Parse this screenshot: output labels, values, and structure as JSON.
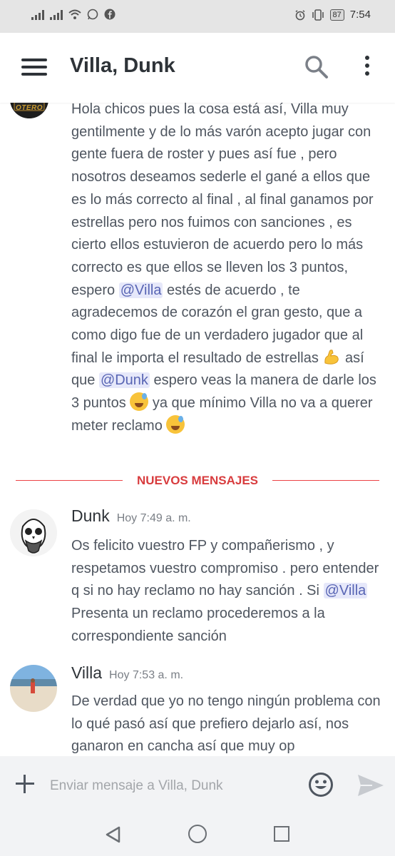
{
  "status_bar": {
    "time": "7:54",
    "battery": "87",
    "left_icons": [
      "signal-icon",
      "signal-icon",
      "wifi-icon",
      "whatsapp-icon",
      "facebook-icon"
    ],
    "right_icons": [
      "alarm-icon",
      "vibrate-icon",
      "battery-icon"
    ]
  },
  "header": {
    "title": "Villa, Dunk",
    "icons": [
      "menu-icon",
      "search-icon",
      "more-vert-icon"
    ]
  },
  "messages": {
    "first_message": {
      "avatar_label": "OTERO",
      "line1": "Hola chicos pues la cosa está así, Villa muy gentilmente y de lo más varón acepto jugar con gente fuera de roster y pues así fue , pero nosotros deseamos sederle el gané a ellos que es lo más correcto al final , al final ganamos por estrellas pero nos fuimos con sanciones , es cierto ellos estuvieron de acuerdo pero lo más correcto es que ellos se lleven los 3 puntos, espero ",
      "mention1": "@Villa",
      "line2": "  estés de acuerdo , te agradecemos de corazón el gran gesto, que a como digo fue de un verdadero jugador que al final le importa el resultado de estrellas ",
      "line3": " así que ",
      "mention2": "@Dunk",
      "line4": "  espero veas la manera de darle los 3 puntos ",
      "line5": " ya que mínimo Villa no va a querer meter reclamo "
    },
    "divider": "NUEVOS MENSAJES",
    "dunk_message": {
      "author": "Dunk",
      "time": "Hoy 7:49 a. m.",
      "text1": "Os felicito vuestro FP y compañerismo , y respetamos vuestro compromiso . pero entender q si no hay reclamo no hay sanción . Si ",
      "mention": "@Villa",
      "text2": " Presenta un reclamo procederemos a la correspondiente sanción"
    },
    "villa_message": {
      "author": "Villa",
      "time": "Hoy 7:53 a. m.",
      "text": "De verdad que yo no tengo ningún problema con lo qué pasó así que prefiero dejarlo así, nos ganaron en cancha así que muy op"
    }
  },
  "input_bar": {
    "placeholder": "Enviar mensaje a Villa, Dunk",
    "icons": [
      "plus-icon",
      "emoji-icon",
      "send-icon"
    ]
  },
  "nav_bar": {
    "icons": [
      "back-icon",
      "home-icon",
      "recent-apps-icon"
    ]
  },
  "colors": {
    "mention_text": "#5865b4",
    "mention_bg": "#e6e8fa",
    "divider_red": "#d83c3e",
    "status_bar_bg": "#e5e5e5",
    "input_bar_bg": "#f2f3f5"
  }
}
